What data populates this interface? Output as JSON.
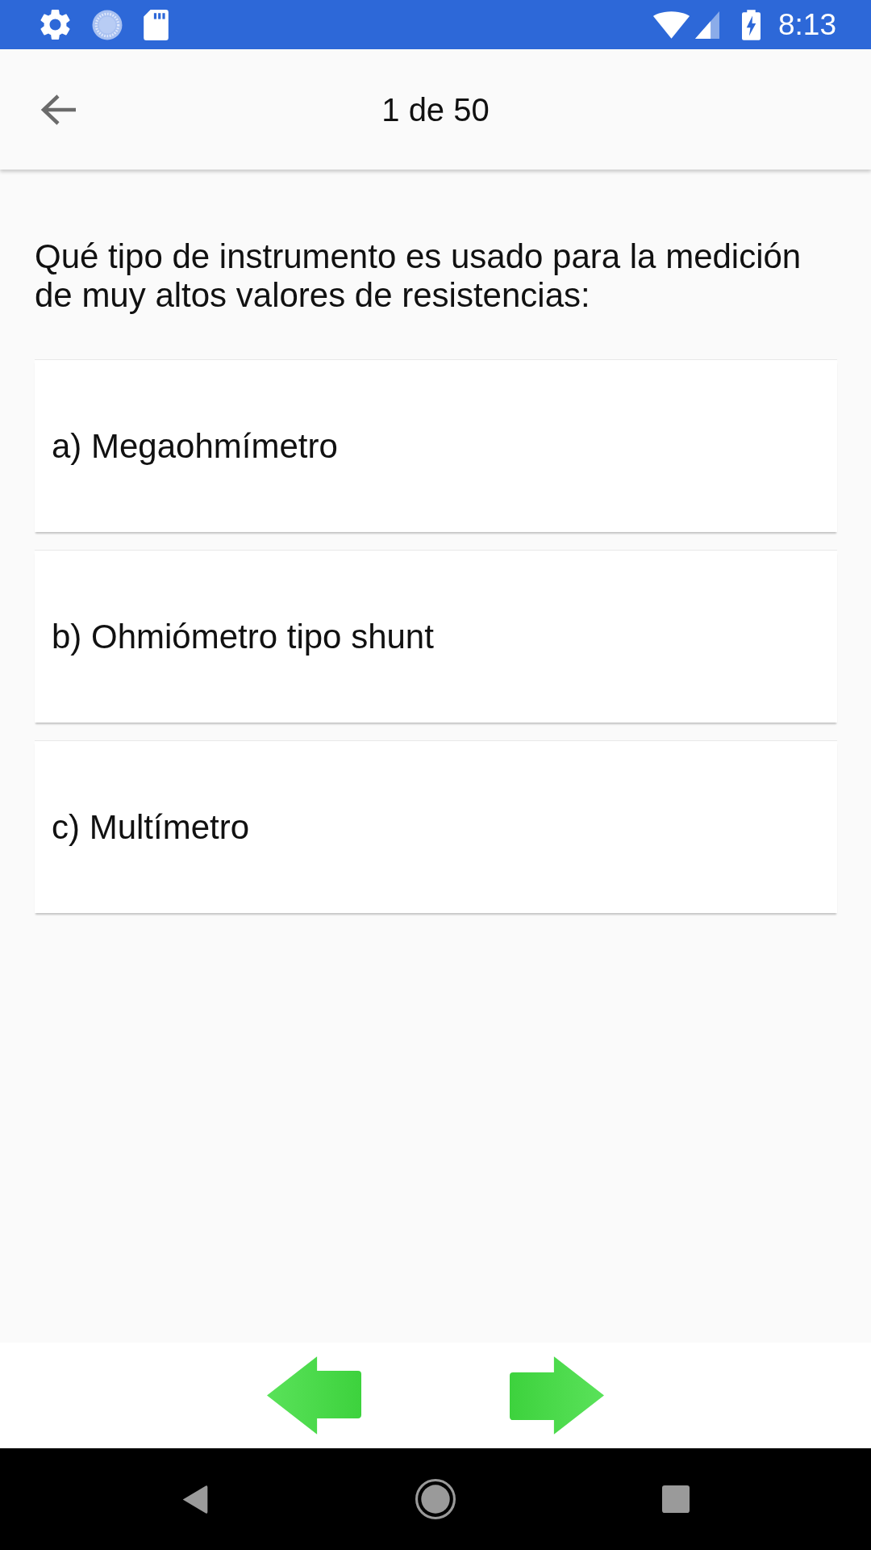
{
  "status_bar": {
    "time": "8:13"
  },
  "app_bar": {
    "title": "1 de 50"
  },
  "question": {
    "text": "Qué tipo de instrumento es usado para la medición de muy altos valores de resistencias:"
  },
  "answers": [
    {
      "text": "a) Megaohmímetro"
    },
    {
      "text": "b) Ohmiómetro tipo shunt"
    },
    {
      "text": "c) Multímetro"
    }
  ]
}
